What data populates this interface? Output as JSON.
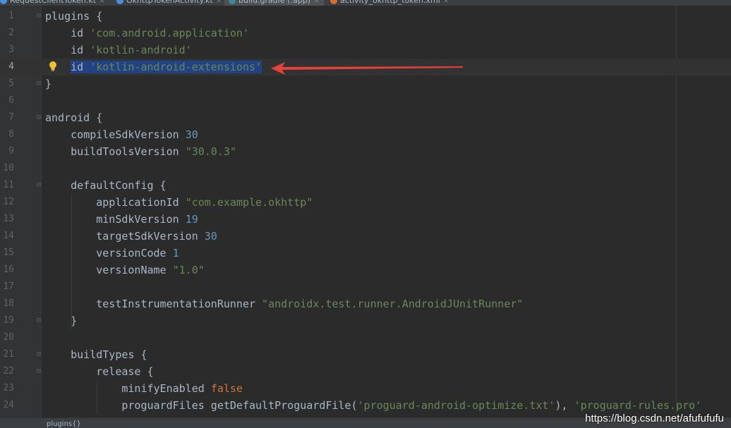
{
  "tabs": [
    {
      "label": "RequestClientToken.kt",
      "icon": "kotlin-file-icon",
      "color": "#4a90d9",
      "active": false
    },
    {
      "label": "OkhttpTokenActivity.kt",
      "icon": "kotlin-file-icon",
      "color": "#4a90d9",
      "active": false
    },
    {
      "label": "build.gradle (:app)",
      "icon": "gradle-file-icon",
      "color": "#3d8b96",
      "active": true
    },
    {
      "label": "activity_okhttp_token.xml",
      "icon": "xml-file-icon",
      "color": "#d66d33",
      "active": false
    }
  ],
  "editor": {
    "caret_line": 4,
    "selected_text": "id 'kotlin-android-extensions'",
    "lines": [
      {
        "n": "1",
        "text": "plugins {"
      },
      {
        "n": "2",
        "text": "    id 'com.android.application'"
      },
      {
        "n": "3",
        "text": "    id 'kotlin-android'"
      },
      {
        "n": "4",
        "text": "    id 'kotlin-android-extensions'"
      },
      {
        "n": "5",
        "text": "}"
      },
      {
        "n": "6",
        "text": ""
      },
      {
        "n": "7",
        "text": "android {"
      },
      {
        "n": "8",
        "text": "    compileSdkVersion 30"
      },
      {
        "n": "9",
        "text": "    buildToolsVersion \"30.0.3\""
      },
      {
        "n": "10",
        "text": ""
      },
      {
        "n": "11",
        "text": "    defaultConfig {"
      },
      {
        "n": "12",
        "text": "        applicationId \"com.example.okhttp\""
      },
      {
        "n": "13",
        "text": "        minSdkVersion 19"
      },
      {
        "n": "14",
        "text": "        targetSdkVersion 30"
      },
      {
        "n": "15",
        "text": "        versionCode 1"
      },
      {
        "n": "16",
        "text": "        versionName \"1.0\""
      },
      {
        "n": "17",
        "text": ""
      },
      {
        "n": "18",
        "text": "        testInstrumentationRunner \"androidx.test.runner.AndroidJUnitRunner\""
      },
      {
        "n": "19",
        "text": "    }"
      },
      {
        "n": "20",
        "text": ""
      },
      {
        "n": "21",
        "text": "    buildTypes {"
      },
      {
        "n": "22",
        "text": "        release {"
      },
      {
        "n": "23",
        "text": "            minifyEnabled false"
      },
      {
        "n": "24",
        "text": "            proguardFiles getDefaultProguardFile('proguard-android-optimize.txt'), 'proguard-rules.pro'"
      }
    ]
  },
  "icons": {
    "bulb": "intention-bulb-icon",
    "arrow": "annotation-arrow",
    "fold": "fold-marker-icon"
  },
  "colors": {
    "background": "#2b2b2b",
    "gutter": "#313335",
    "keyword": "#cc7832",
    "string": "#6a8759",
    "number": "#6897bb",
    "text": "#a9b7c6",
    "selection": "#214283",
    "annotation_arrow": "#e8403a",
    "bulb": "#f2c037"
  },
  "status": {
    "breadcrumb": "plugins{}"
  },
  "watermark": "https://blog.csdn.net/afufufufu"
}
